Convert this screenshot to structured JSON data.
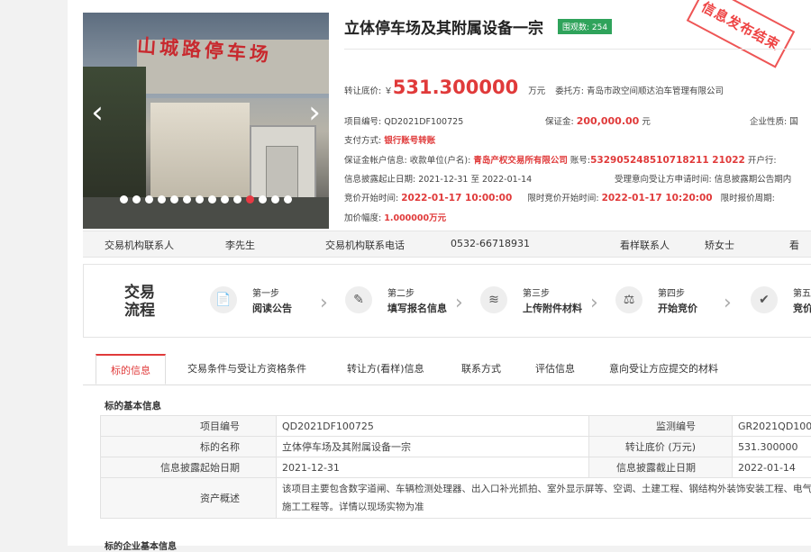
{
  "listing": {
    "title": "立体停车场及其附属设备一宗",
    "views_badge": "围观数: 254",
    "stamp_text": "信息发布结束",
    "gallery_sign": "山城路停车场",
    "price_label": "转让底价: ￥",
    "price_value": "531.300000",
    "price_unit": "万元",
    "entrust_label": "委托方: 青岛市政空间顺达泊车管理有限公司",
    "project_no": "项目编号: QD2021DF100725",
    "deposit_label": "保证金:",
    "deposit_value": "200,000.00",
    "deposit_unit": "元",
    "enterprise_label": "企业性质: 国",
    "pay_label": "支付方式:",
    "pay_value": "银行账号转账",
    "account_label": "保证金帐户信息: 收款单位(户名):",
    "account_name": "青岛产权交易所有限公司",
    "account_no_label": "账号:",
    "account_no": "532905248510718211 21022",
    "bank_label": "开户行:",
    "disclose_period": "信息披露起止日期: 2021-12-31 至 2022-01-14",
    "intent_label": "受理意向受让方申请时间: 信息披露期公告期内",
    "bid_start_label": "竞价开始时间:",
    "bid_start": "2022-01-17 10:00:00",
    "timed_start_label": "限时竞价开始时间:",
    "timed_start": "2022-01-17 10:20:00",
    "timed_period_label": "限时报价周期:",
    "increment_label": "加价幅度:",
    "increment": "1.000000万元"
  },
  "contacts": {
    "org_contact_label": "交易机构联系人",
    "org_contact": "李先生",
    "org_phone_label": "交易机构联系电话",
    "org_phone": "0532-66718931",
    "viewing_label": "看样联系人",
    "viewing_contact": "矫女士",
    "more_label": "看"
  },
  "flow": {
    "title": "交易流程",
    "steps": [
      {
        "step": "第一步",
        "name": "阅读公告",
        "icon": "📄"
      },
      {
        "step": "第二步",
        "name": "填写报名信息",
        "icon": "✎"
      },
      {
        "step": "第三步",
        "name": "上传附件材料",
        "icon": "≋"
      },
      {
        "step": "第四步",
        "name": "开始竞价",
        "icon": "⚖"
      },
      {
        "step": "第五",
        "name": "竞价",
        "icon": "✔"
      }
    ]
  },
  "tabs": [
    "标的信息",
    "交易条件与受让方资格条件",
    "转让方(看样)信息",
    "联系方式",
    "评估信息",
    "意向受让方应提交的材料"
  ],
  "table": {
    "section_title": "标的基本信息",
    "rows": [
      [
        "项目编号",
        "QD2021DF100725",
        "监测编号",
        "GR2021QD100"
      ],
      [
        "标的名称",
        "立体停车场及其附属设备一宗",
        "转让底价 (万元)",
        "531.300000"
      ],
      [
        "信息披露起始日期",
        "2021-12-31",
        "信息披露截止日期",
        "2022-01-14"
      ]
    ],
    "asset_label": "资产概述",
    "asset_text": "该项目主要包含数字道闸、车辆检测处理器、出入口补光抓拍、室外显示屏等、空调、土建工程、钢结构外装饰安装工程、电气施工工程等。详情以现场实物为准",
    "next_section": "标的企业基本信息"
  },
  "colors": {
    "accent": "#e03a3a",
    "badge": "#2fa35b"
  }
}
